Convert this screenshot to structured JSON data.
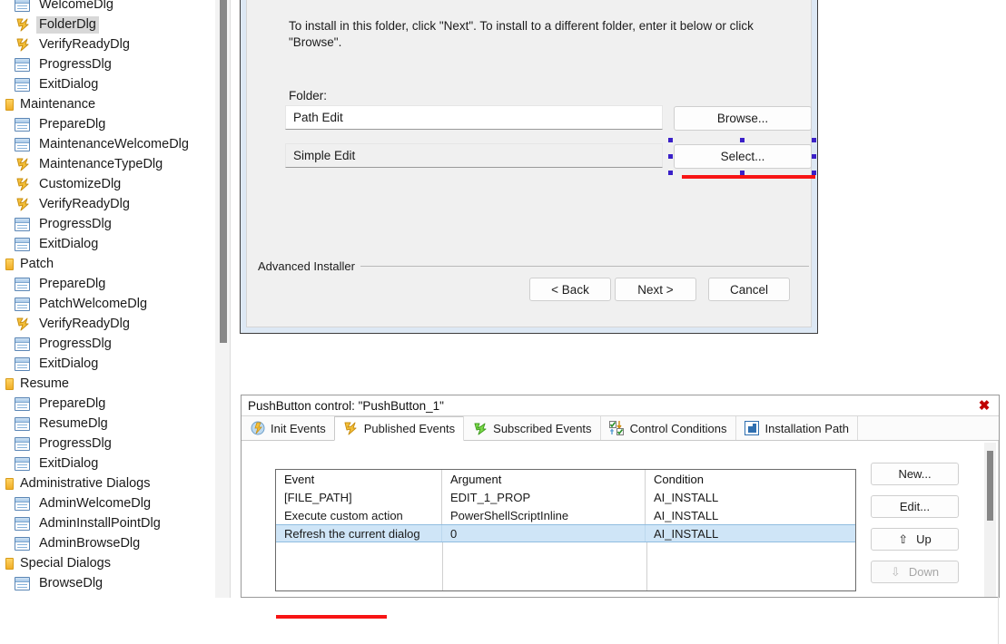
{
  "tree": {
    "items": [
      {
        "label": "WelcomeDlg",
        "icon": "dialog-icon",
        "indent": "child",
        "selected": false
      },
      {
        "label": "FolderDlg",
        "icon": "lightning-icon",
        "indent": "child",
        "selected": true
      },
      {
        "label": "VerifyReadyDlg",
        "icon": "lightning-icon",
        "indent": "child",
        "selected": false
      },
      {
        "label": "ProgressDlg",
        "icon": "dialog-icon",
        "indent": "child",
        "selected": false
      },
      {
        "label": "ExitDialog",
        "icon": "dialog-icon",
        "indent": "child",
        "selected": false
      },
      {
        "label": "Maintenance",
        "icon": "folder-icon",
        "indent": "group",
        "selected": false
      },
      {
        "label": "PrepareDlg",
        "icon": "dialog-icon",
        "indent": "child",
        "selected": false
      },
      {
        "label": "MaintenanceWelcomeDlg",
        "icon": "dialog-icon",
        "indent": "child",
        "selected": false
      },
      {
        "label": "MaintenanceTypeDlg",
        "icon": "lightning-icon",
        "indent": "child",
        "selected": false
      },
      {
        "label": "CustomizeDlg",
        "icon": "lightning-icon",
        "indent": "child",
        "selected": false
      },
      {
        "label": "VerifyReadyDlg",
        "icon": "lightning-icon",
        "indent": "child",
        "selected": false
      },
      {
        "label": "ProgressDlg",
        "icon": "dialog-icon",
        "indent": "child",
        "selected": false
      },
      {
        "label": "ExitDialog",
        "icon": "dialog-icon",
        "indent": "child",
        "selected": false
      },
      {
        "label": "Patch",
        "icon": "folder-icon",
        "indent": "group",
        "selected": false
      },
      {
        "label": "PrepareDlg",
        "icon": "dialog-icon",
        "indent": "child",
        "selected": false
      },
      {
        "label": "PatchWelcomeDlg",
        "icon": "dialog-icon",
        "indent": "child",
        "selected": false
      },
      {
        "label": "VerifyReadyDlg",
        "icon": "lightning-icon",
        "indent": "child",
        "selected": false
      },
      {
        "label": "ProgressDlg",
        "icon": "dialog-icon",
        "indent": "child",
        "selected": false
      },
      {
        "label": "ExitDialog",
        "icon": "dialog-icon",
        "indent": "child",
        "selected": false
      },
      {
        "label": "Resume",
        "icon": "folder-icon",
        "indent": "group",
        "selected": false
      },
      {
        "label": "PrepareDlg",
        "icon": "dialog-icon",
        "indent": "child",
        "selected": false
      },
      {
        "label": "ResumeDlg",
        "icon": "dialog-icon",
        "indent": "child",
        "selected": false
      },
      {
        "label": "ProgressDlg",
        "icon": "dialog-icon",
        "indent": "child",
        "selected": false
      },
      {
        "label": "ExitDialog",
        "icon": "dialog-icon",
        "indent": "child",
        "selected": false
      },
      {
        "label": "Administrative Dialogs",
        "icon": "folder-icon",
        "indent": "group",
        "selected": false
      },
      {
        "label": "AdminWelcomeDlg",
        "icon": "dialog-icon",
        "indent": "child",
        "selected": false
      },
      {
        "label": "AdminInstallPointDlg",
        "icon": "dialog-icon",
        "indent": "child",
        "selected": false
      },
      {
        "label": "AdminBrowseDlg",
        "icon": "dialog-icon",
        "indent": "child",
        "selected": false
      },
      {
        "label": "Special Dialogs",
        "icon": "folder-icon",
        "indent": "group",
        "selected": false
      },
      {
        "label": "BrowseDlg",
        "icon": "dialog-icon",
        "indent": "child",
        "selected": false
      }
    ]
  },
  "dialog_preview": {
    "description": "To install in this folder, click \"Next\". To install to a different folder, enter it below or click \"Browse\".",
    "folder_label": "Folder:",
    "path_edit_value": "Path Edit",
    "simple_edit_value": "Simple Edit",
    "browse_button": "Browse...",
    "select_button": "Select...",
    "brand": "Advanced Installer",
    "back_button": "< Back",
    "next_button": "Next >",
    "cancel_button": "Cancel",
    "selection_handle_color": "#3a20c8",
    "annotation_color": "#f71414"
  },
  "bottom_panel": {
    "title": "PushButton control: \"PushButton_1\"",
    "close_label": "✖",
    "tabs": [
      {
        "label": "Init Events",
        "icon": "init-events-icon",
        "active": false
      },
      {
        "label": "Published Events",
        "icon": "published-events-icon",
        "active": true
      },
      {
        "label": "Subscribed Events",
        "icon": "subscribed-events-icon",
        "active": false
      },
      {
        "label": "Control Conditions",
        "icon": "control-conditions-icon",
        "active": false
      },
      {
        "label": "Installation Path",
        "icon": "installation-path-icon",
        "active": false
      }
    ],
    "grid": {
      "columns": [
        "Event",
        "Argument",
        "Condition"
      ],
      "rows": [
        {
          "event": "[FILE_PATH]",
          "argument": "EDIT_1_PROP",
          "condition": "AI_INSTALL",
          "selected": false
        },
        {
          "event": "Execute custom action",
          "argument": "PowerShellScriptInline",
          "condition": "AI_INSTALL",
          "selected": false
        },
        {
          "event": "Refresh the current dialog",
          "argument": "0",
          "condition": "AI_INSTALL",
          "selected": true
        }
      ]
    },
    "buttons": [
      {
        "label": "New...",
        "icon": "",
        "disabled": false
      },
      {
        "label": "Edit...",
        "icon": "",
        "disabled": false
      },
      {
        "label": "Up",
        "icon": "⇧",
        "disabled": false
      },
      {
        "label": "Down",
        "icon": "⇩",
        "disabled": true
      }
    ]
  }
}
